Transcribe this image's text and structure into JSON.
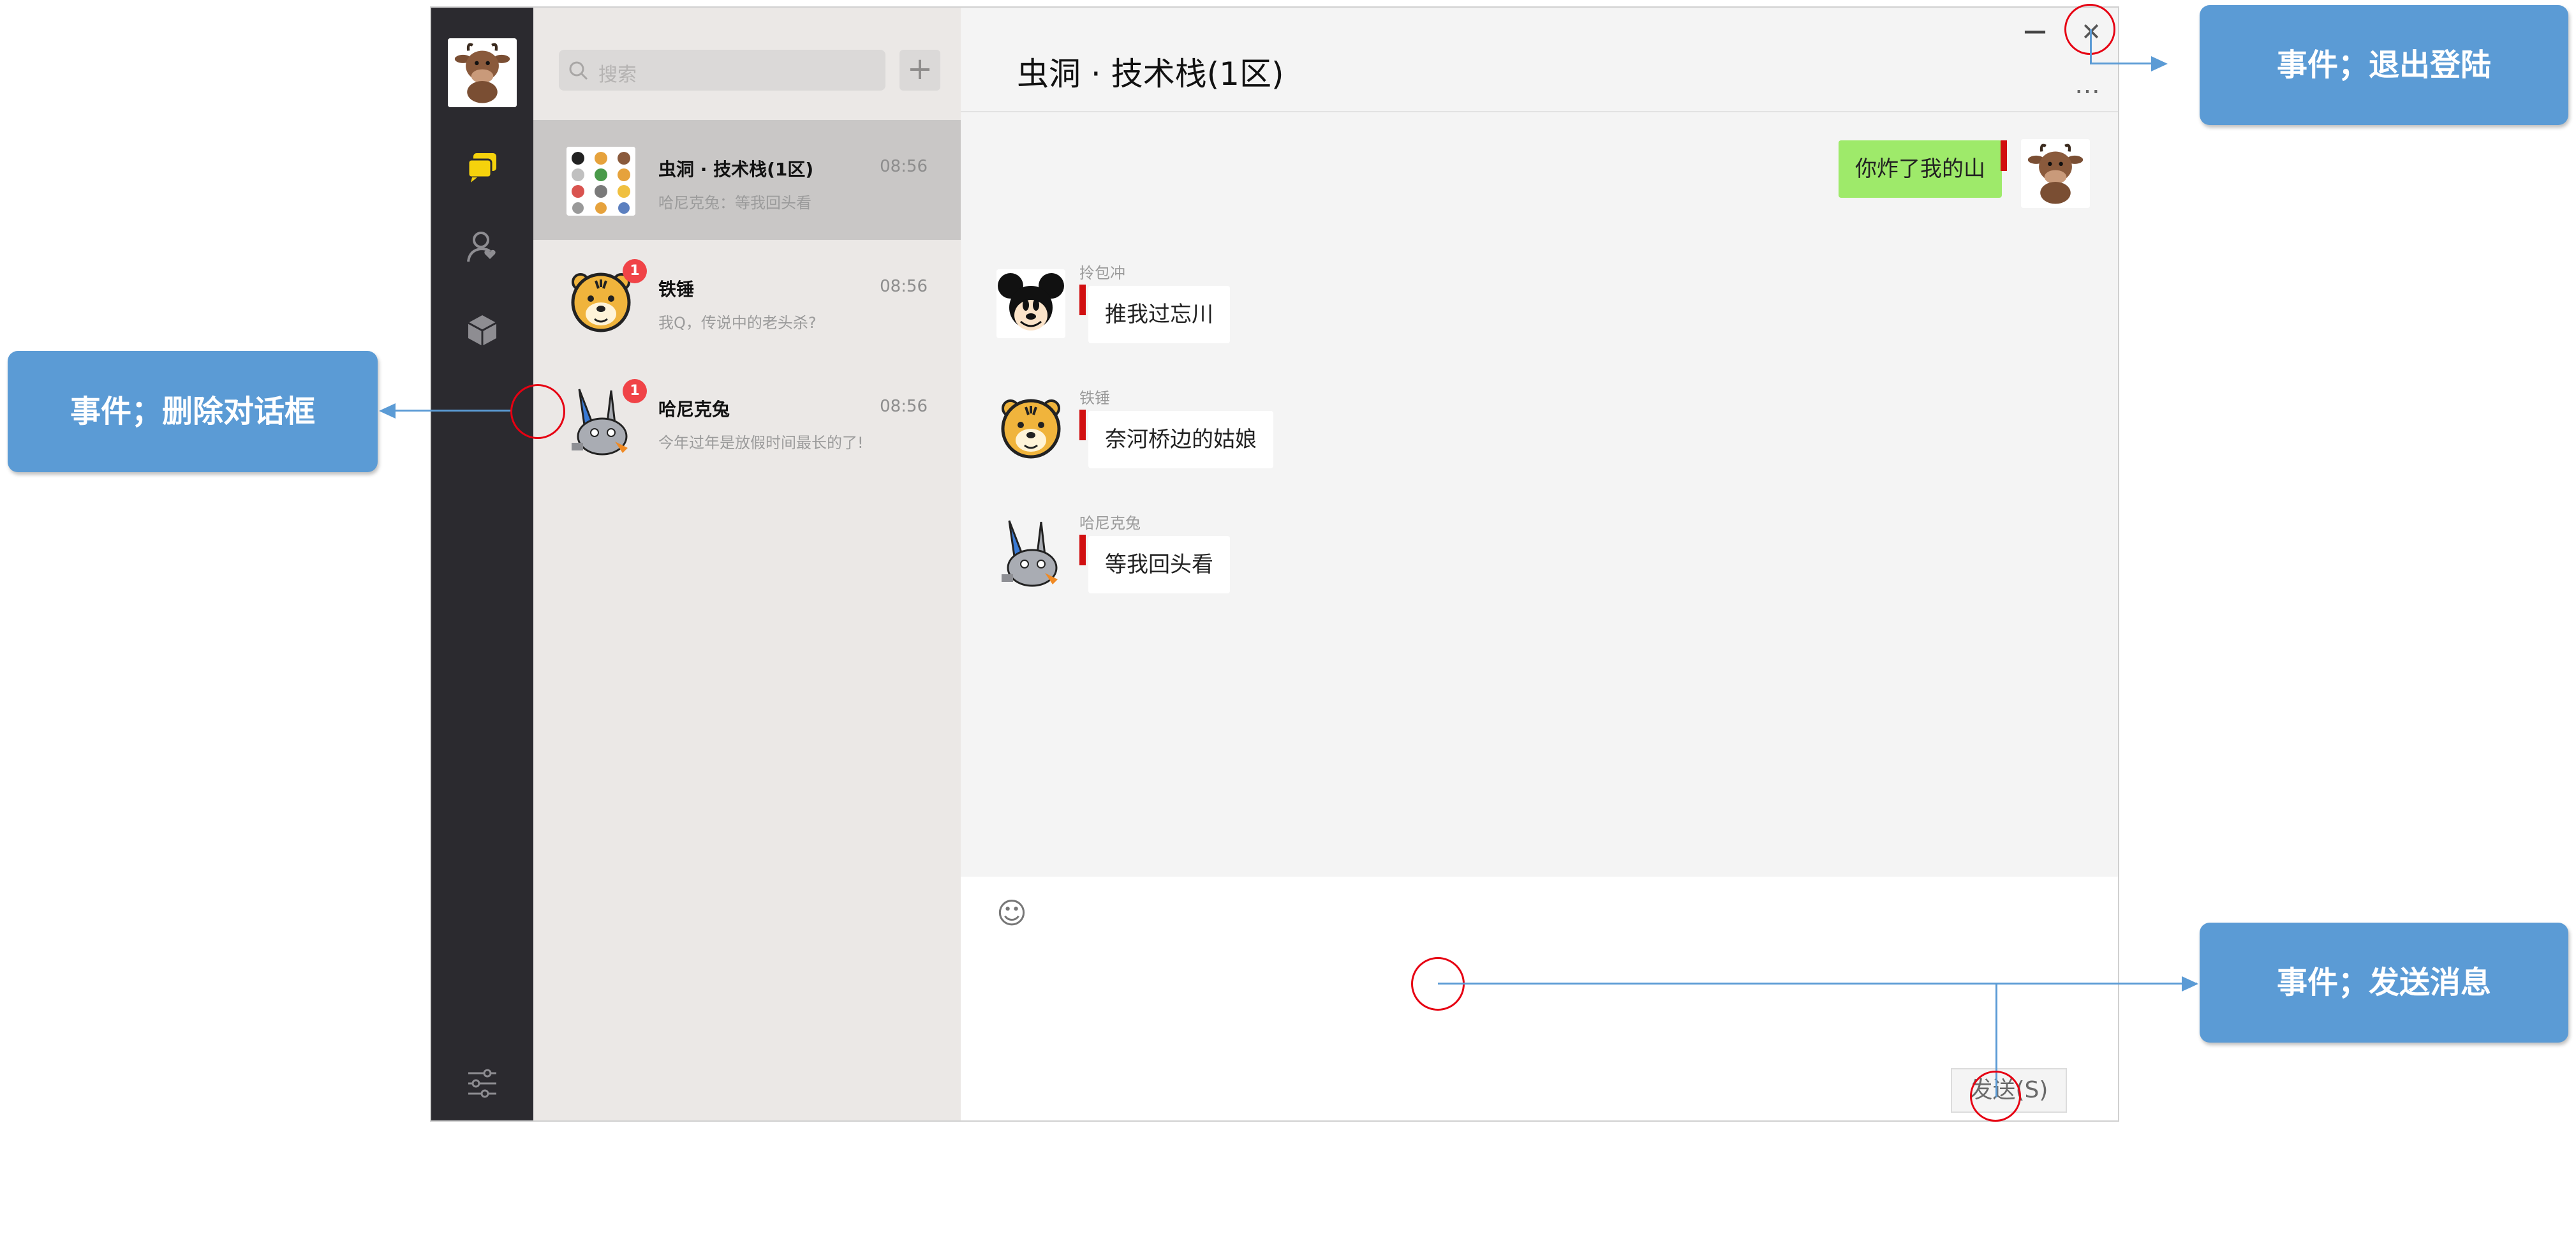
{
  "search": {
    "placeholder": "搜索",
    "add_label": "+"
  },
  "chat": {
    "title": "虫洞 · 技术栈(1区)",
    "more_label": "…",
    "minimize_label": "—",
    "close_label": "✕",
    "send_label": "发送(S)",
    "emoji_label": "☺"
  },
  "conversations": [
    {
      "name": "虫洞 · 技术栈(1区)",
      "time": "08:56",
      "preview": "哈尼克兔：等我回头看",
      "badge": ""
    },
    {
      "name": "铁锤",
      "time": "08:56",
      "preview": "我Q，传说中的老头杀?",
      "badge": "1"
    },
    {
      "name": "哈尼克兔",
      "time": "08:56",
      "preview": "今年过年是放假时间最长的了!",
      "badge": "1"
    }
  ],
  "messages": [
    {
      "sender": "",
      "text": "你炸了我的山",
      "direction": "out"
    },
    {
      "sender": "拎包冲",
      "text": "推我过忘川",
      "direction": "in"
    },
    {
      "sender": "铁锤",
      "text": "奈河桥边的姑娘",
      "direction": "in"
    },
    {
      "sender": "哈尼克兔",
      "text": "等我回头看",
      "direction": "in"
    }
  ],
  "callouts": {
    "logout": "事件；退出登陆",
    "delete": "事件；删除对话框",
    "send": "事件；发送消息"
  },
  "colors": {
    "sidebar": "#2b2a2f",
    "list_bg": "#ebe8e6",
    "active_item": "#c9c7c6",
    "bubble_out": "#9eea6a",
    "callout": "#5b9bd5",
    "circle": "#e60012",
    "chat_icon_active": "#f5d20c"
  },
  "icons": [
    "cow-avatar-icon",
    "chat-icon",
    "contacts-icon",
    "box-icon",
    "settings-icon",
    "search-icon",
    "plus-icon",
    "emoji-icon",
    "close-icon",
    "minimize-icon",
    "more-icon"
  ]
}
